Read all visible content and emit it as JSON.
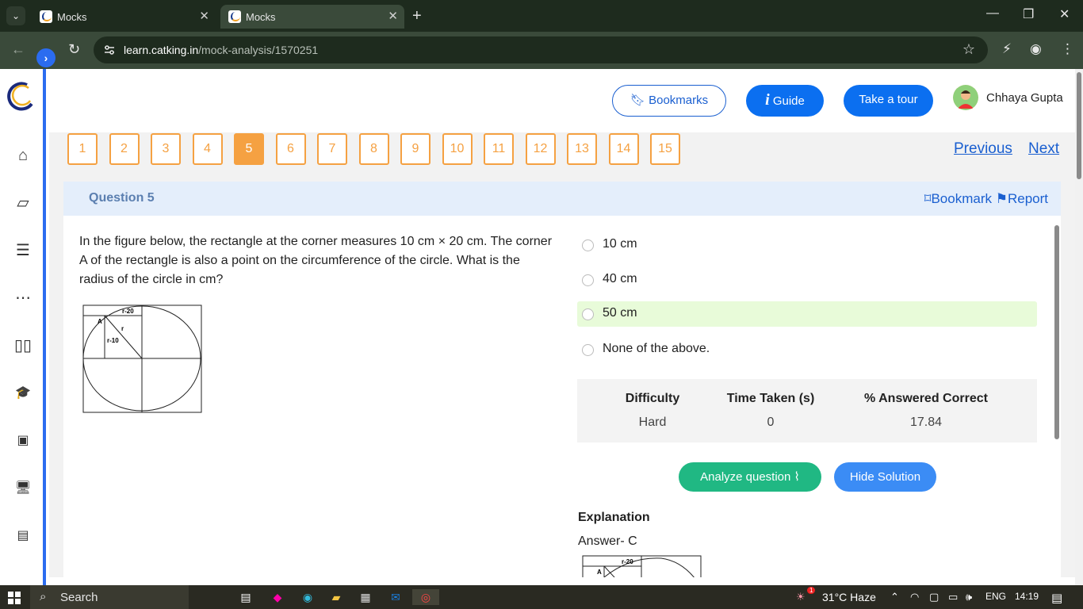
{
  "browser": {
    "tabs": [
      {
        "title": "Mocks",
        "active": false
      },
      {
        "title": "Mocks",
        "active": true
      }
    ],
    "url_host": "learn.catking.in",
    "url_path": "/mock-analysis/1570251"
  },
  "header": {
    "bookmarks_label": "Bookmarks",
    "guide_label": "Guide",
    "tour_label": "Take a tour",
    "user_name": "Chhaya Gupta"
  },
  "question_nav": {
    "numbers": [
      "1",
      "2",
      "3",
      "4",
      "5",
      "6",
      "7",
      "8",
      "9",
      "10",
      "11",
      "12",
      "13",
      "14",
      "15"
    ],
    "active": "5",
    "previous_label": "Previous",
    "next_label": "Next"
  },
  "question": {
    "title": "Question 5",
    "bookmark_label": "Bookmark",
    "report_label": "Report",
    "text": "In the figure below, the rectangle at the corner measures 10 cm × 20 cm. The corner A of the rectangle is also a point on the circumference of the circle. What is the radius of the circle in cm?",
    "figure_labels": {
      "top": "r-20",
      "left": "r-10",
      "radius": "r",
      "corner": "A"
    },
    "options": [
      {
        "label": "10 cm",
        "selected": false
      },
      {
        "label": "40 cm",
        "selected": false
      },
      {
        "label": "50 cm",
        "selected": true
      },
      {
        "label": "None of the above.",
        "selected": false
      }
    ]
  },
  "stats": {
    "headers": [
      "Difficulty",
      "Time Taken (s)",
      "% Answered Correct"
    ],
    "values": [
      "Hard",
      "0",
      "17.84"
    ]
  },
  "actions": {
    "analyze_label": "Analyze question",
    "hide_label": "Hide Solution"
  },
  "explanation": {
    "heading": "Explanation",
    "answer": "Answer- C"
  },
  "taskbar": {
    "search_label": "Search",
    "weather": "31°C  Haze",
    "lang": "ENG",
    "time": "14:19",
    "notif_count": "1"
  },
  "colors": {
    "accent": "#0b6ff0",
    "qnum_orange": "#f5a142",
    "selected_bg": "#e8fbd9",
    "analyze_green": "#20b883"
  }
}
